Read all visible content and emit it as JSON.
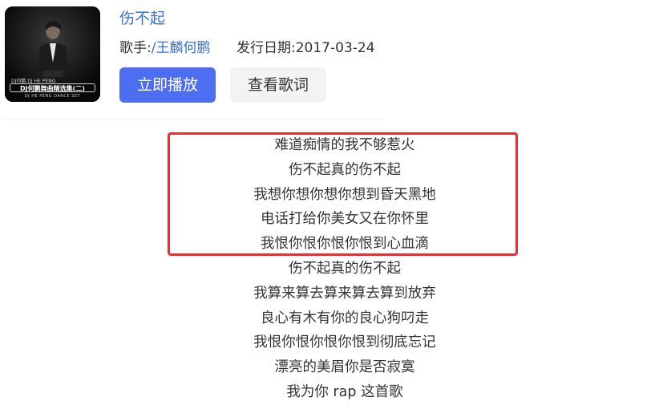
{
  "cover": {
    "top_text": "DJ何鹏 DJ HE PENG",
    "series_text": "DJ何鹏舞曲精选集(二)",
    "sub_text": "DJ HE PENG DANCE SET"
  },
  "song": {
    "title": "伤不起",
    "singer_label": "歌手:",
    "singer_name": "/王麟何鹏",
    "release_date_label": "发行日期:",
    "release_date": "2017-03-24"
  },
  "buttons": {
    "play": "立即播放",
    "view_lyrics": "查看歌词"
  },
  "lyrics": [
    "难道痴情的我不够惹火",
    "伤不起真的伤不起",
    "我想你想你想你想到昏天黑地",
    "电话打给你美女又在你怀里",
    "我恨你恨你恨你恨到心血滴",
    "伤不起真的伤不起",
    "我算来算去算来算去算到放弃",
    "良心有木有你的良心狗叼走",
    "我恨你恨你恨你恨到彻底忘记",
    "漂亮的美眉你是否寂寞",
    "我为你 rap 这首歌"
  ],
  "colors": {
    "accent": "#4e6ef2",
    "link": "#3a6fd8",
    "highlight_border": "#ee2e2e"
  }
}
